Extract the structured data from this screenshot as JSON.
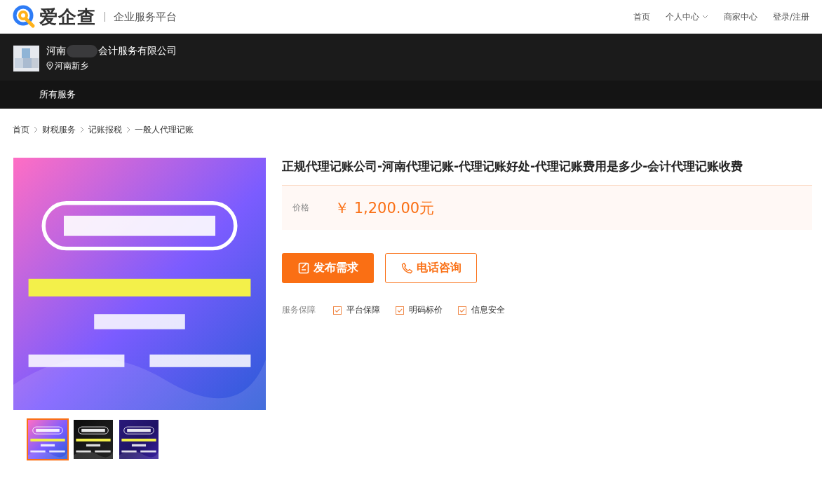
{
  "header": {
    "logo_text": "爱企查",
    "platform": "企业服务平台",
    "nav": [
      {
        "label": "首页",
        "dropdown": false
      },
      {
        "label": "个人中心",
        "dropdown": true
      },
      {
        "label": "商家中心",
        "dropdown": false
      },
      {
        "label": "登录/注册",
        "dropdown": false
      }
    ]
  },
  "shop": {
    "name_start": "河南",
    "name_end": "会计服务有限公司",
    "location": "河南新乡",
    "tabs": [
      {
        "label": "所有服务",
        "selected": true
      }
    ]
  },
  "breadcrumb": [
    "首页",
    "财税服务",
    "记账报税",
    "一般人代理记账"
  ],
  "product": {
    "title": "正规代理记账公司-河南代理记账-代理记账好处-代理记账费用是多少-会计代理记账收费",
    "price_label": "价格",
    "price": "￥ 1,200.00元",
    "buttons": [
      {
        "kind": "primary",
        "label": "发布需求"
      },
      {
        "kind": "outline",
        "label": "电话咨询"
      }
    ],
    "guarantee_label": "服务保障",
    "guarantees": [
      {
        "label": "平台保障",
        "checked": true
      },
      {
        "label": "明码标价",
        "checked": true
      },
      {
        "label": "信息安全",
        "checked": true
      }
    ],
    "thumbnails": [
      {
        "kind": "picture",
        "selected": true
      },
      {
        "kind": "picture",
        "selected": false
      },
      {
        "kind": "picture",
        "selected": false
      }
    ]
  }
}
